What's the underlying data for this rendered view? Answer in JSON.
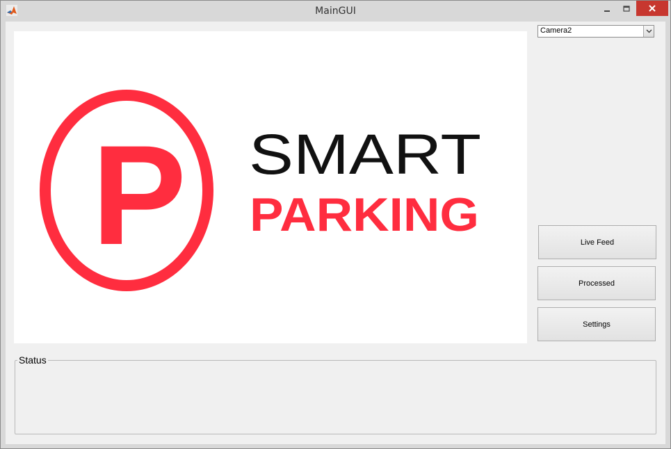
{
  "window": {
    "title": "MainGUI"
  },
  "logo": {
    "line1": "SMART",
    "line2": "PARKING",
    "symbol": "P",
    "brand_color": "#ff2d3f",
    "text_color": "#111111"
  },
  "camera_select": {
    "selected": "Camera2"
  },
  "buttons": {
    "live_feed": "Live Feed",
    "processed": "Processed",
    "settings": "Settings"
  },
  "status": {
    "label": "Status",
    "text": ""
  },
  "icons": {
    "app": "matlab-icon",
    "minimize": "minimize-icon",
    "maximize": "maximize-icon",
    "close": "close-icon",
    "dropdown": "chevron-down-icon"
  }
}
